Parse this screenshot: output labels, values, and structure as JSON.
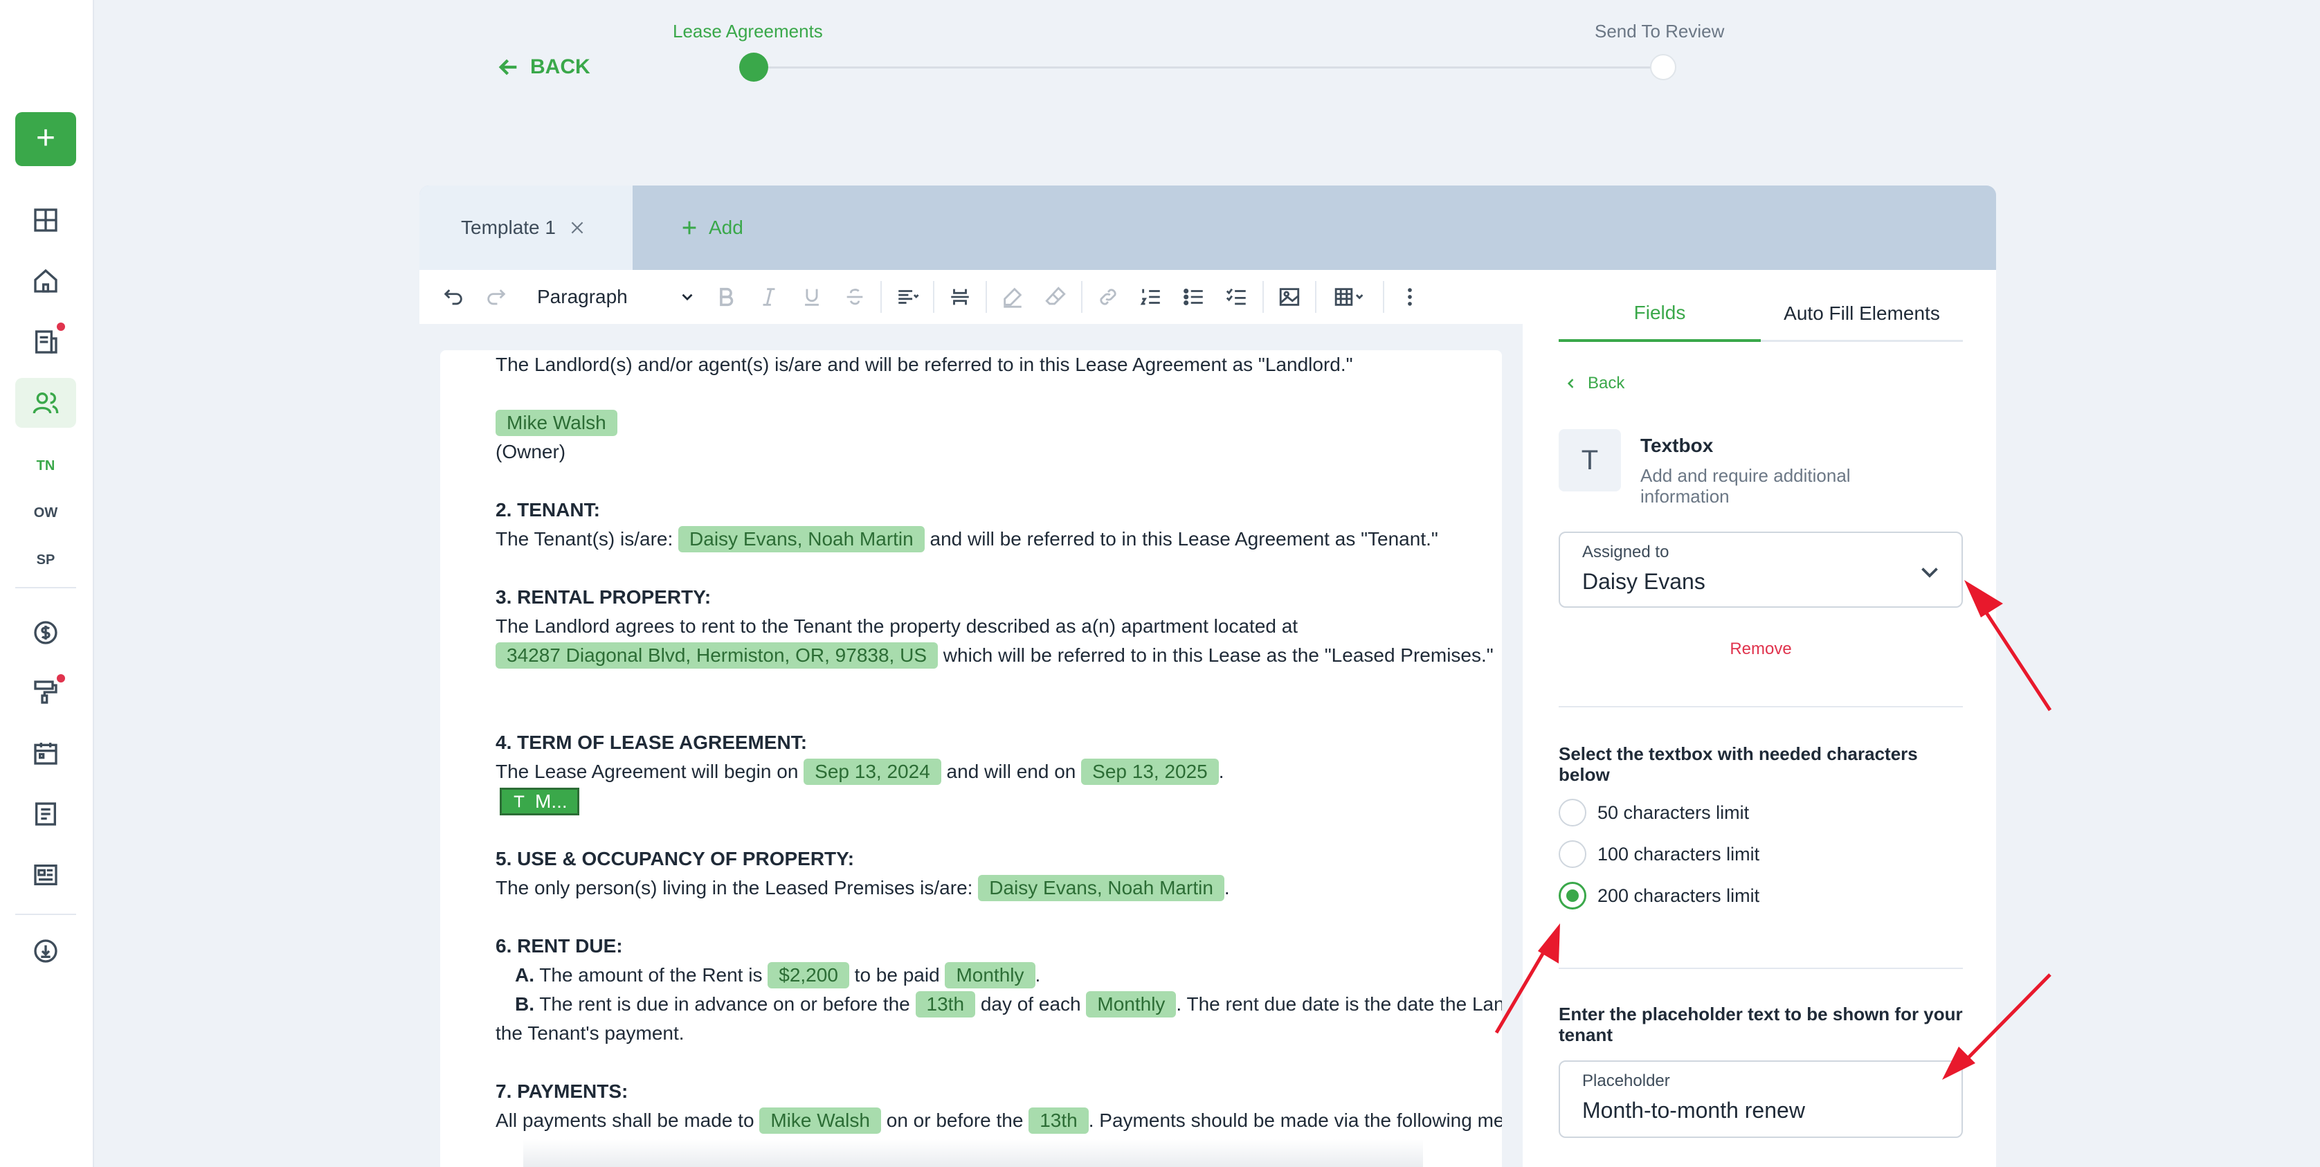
{
  "sidebar": {
    "add_label": "+",
    "items": [
      {
        "icon": "dashboard-icon"
      },
      {
        "icon": "home-icon"
      },
      {
        "icon": "reports-icon",
        "badge": true
      },
      {
        "icon": "people-icon",
        "active": true
      },
      {
        "icon": "dollar-icon"
      },
      {
        "icon": "paint-roller-icon",
        "badge": true
      },
      {
        "icon": "calendar-icon"
      },
      {
        "icon": "document-icon"
      },
      {
        "icon": "news-icon"
      },
      {
        "icon": "cloud-download-icon"
      }
    ],
    "sub_items": [
      "TN",
      "OW",
      "SP"
    ]
  },
  "header": {
    "back_label": "BACK",
    "steps": [
      {
        "label": "Lease Agreements",
        "active": true
      },
      {
        "label": "Send To Review",
        "active": false
      }
    ]
  },
  "tabs": {
    "items": [
      {
        "label": "Template 1"
      }
    ],
    "add_label": "Add"
  },
  "toolbar": {
    "block_style": "Paragraph"
  },
  "document": {
    "l1": "The Landlord(s) and/or agent(s) is/are and will be referred to in this Lease Agreement as \"Landlord.\"",
    "landlord_name": "Mike Walsh",
    "owner_label": "(Owner)",
    "s2_heading": "2. TENANT:",
    "s2_pre": "The Tenant(s) is/are:",
    "tenants": "Daisy Evans, Noah Martin",
    "s2_post": "and will be referred to in this Lease Agreement as \"Tenant.\"",
    "s3_heading": "3. RENTAL PROPERTY:",
    "s3_line": "The Landlord agrees to rent to the Tenant the property described as a(n) apartment located at",
    "address": "34287 Diagonal Blvd, Hermiston, OR, 97838, US",
    "s3_post": "which will be referred to in this Lease as the \"Leased Premises.\"",
    "s4_heading": "4. TERM OF LEASE AGREEMENT:",
    "s4_pre": "The Lease Agreement will begin on",
    "start_date": "Sep 13, 2024",
    "s4_mid": "and will end on",
    "end_date": "Sep 13, 2025",
    "s4_end": ".",
    "textbox_chip": "M...",
    "s5_heading": "5. USE & OCCUPANCY OF PROPERTY:",
    "s5_pre": "The only person(s) living in the Leased Premises is/are:",
    "occupants": "Daisy Evans, Noah Martin",
    "s5_end": ".",
    "s6_heading": "6. RENT DUE:",
    "s6a_label": "A.",
    "s6a_pre": "The amount of the Rent is",
    "rent_amount": "$2,200",
    "s6a_mid": "to be paid",
    "rent_frequency": "Monthly",
    "s6a_end": ".",
    "s6b_label": "B.",
    "s6b_pre": "The rent is due in advance on or before the",
    "due_day": "13th",
    "s6b_mid": "day of each",
    "due_period": "Monthly",
    "s6b_post": ". The rent due date is the date the Landl",
    "s6b_cont": "the Tenant's payment.",
    "s7_heading": "7. PAYMENTS:",
    "s7_pre": "All payments shall be made to",
    "payee": "Mike Walsh",
    "s7_mid": "on or before the",
    "payment_day": "13th",
    "s7_post": ". Payments should be made via the following meth"
  },
  "right_panel": {
    "tabs": [
      {
        "label": "Fields",
        "active": true
      },
      {
        "label": "Auto Fill Elements",
        "active": false
      }
    ],
    "back_label": "Back",
    "field_icon": "T",
    "field_title": "Textbox",
    "field_desc": "Add and require additional information",
    "assigned_label": "Assigned to",
    "assigned_value": "Daisy Evans",
    "remove_label": "Remove",
    "limit_title": "Select the textbox with needed characters below",
    "limits": [
      {
        "label": "50 characters limit",
        "selected": false
      },
      {
        "label": "100 characters limit",
        "selected": false
      },
      {
        "label": "200 characters limit",
        "selected": true
      }
    ],
    "placeholder_title": "Enter the placeholder text to be shown for your tenant",
    "placeholder_label": "Placeholder",
    "placeholder_value": "Month-to-month renew"
  },
  "colors": {
    "accent": "#3aa84a",
    "pill_bg": "#a8dcad",
    "danger": "#e0334d",
    "annotation": "#e8192c"
  }
}
